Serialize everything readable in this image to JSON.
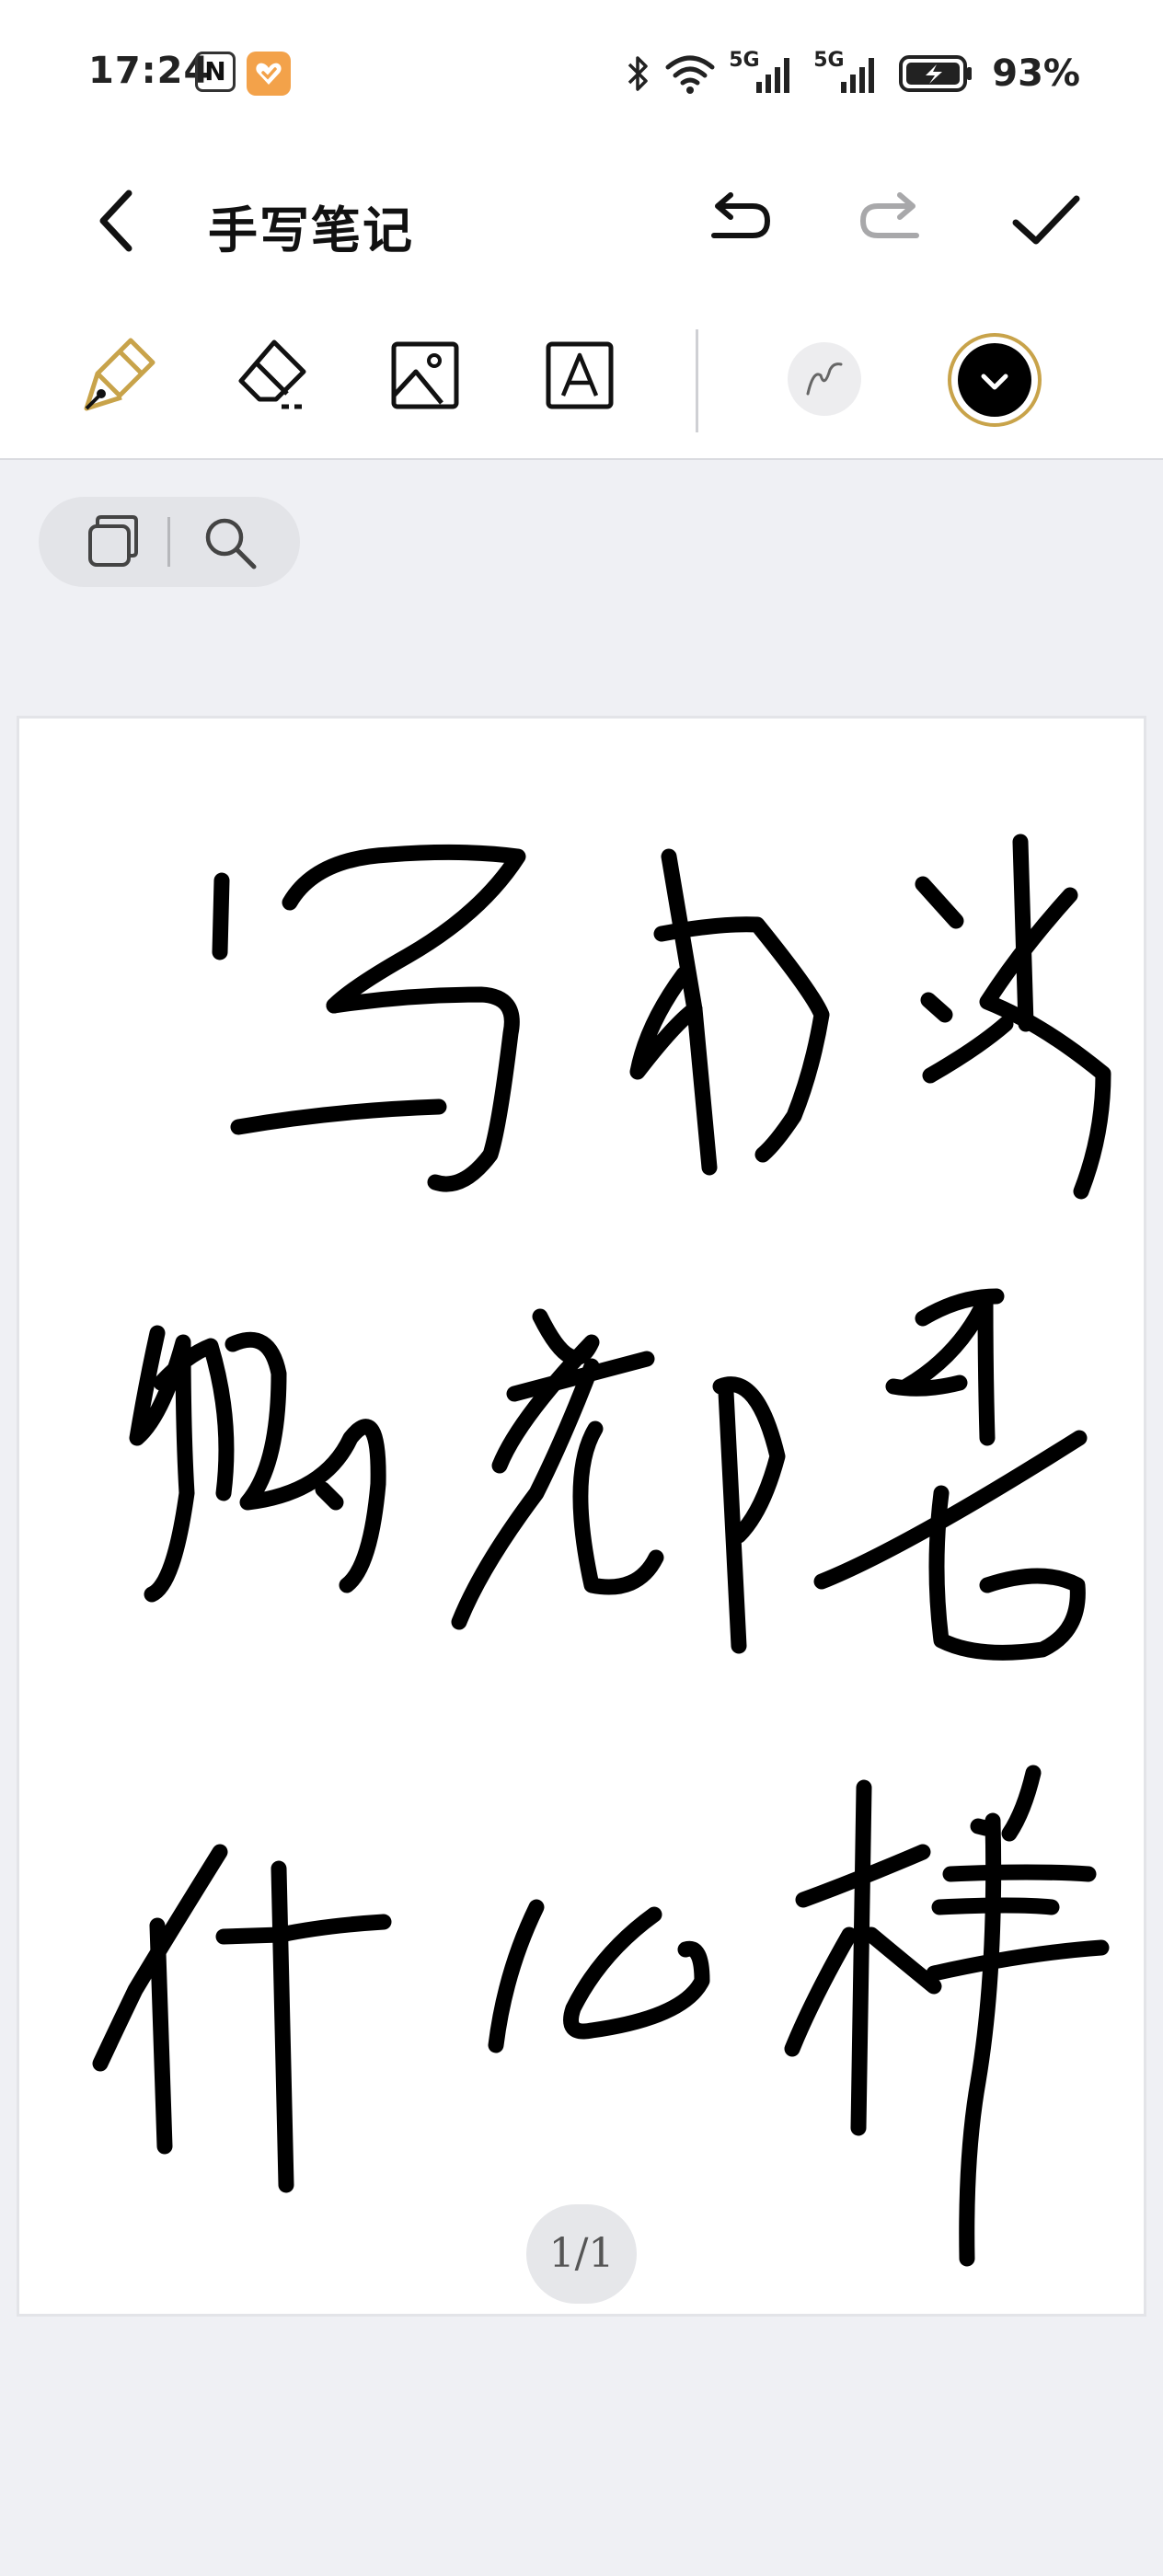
{
  "status_bar": {
    "time": "17:24",
    "icons": [
      "nfc-icon",
      "app-notification-icon",
      "bluetooth-icon",
      "wifi-icon",
      "signal-5g-icon",
      "signal-5g-icon",
      "charging-battery-icon"
    ],
    "network_1": "5G",
    "network_2": "5G",
    "battery_pct": "93%"
  },
  "header": {
    "title": "手写笔记",
    "icons": [
      "back-icon",
      "undo-icon",
      "redo-icon",
      "check-icon"
    ],
    "redo_enabled": false
  },
  "toolbar": {
    "tools": [
      "pen-icon",
      "eraser-icon",
      "image-icon",
      "text-box-icon"
    ],
    "selected_tool": "pen",
    "accent_color": "#c8a34a",
    "pen_color": "#000000"
  },
  "page_tools": {
    "icons": [
      "pages-icon",
      "search-icon"
    ]
  },
  "canvas": {
    "handwriting_lines": [
      "写书法",
      "的都是",
      "什么样"
    ]
  },
  "page_indicator": "1/1"
}
